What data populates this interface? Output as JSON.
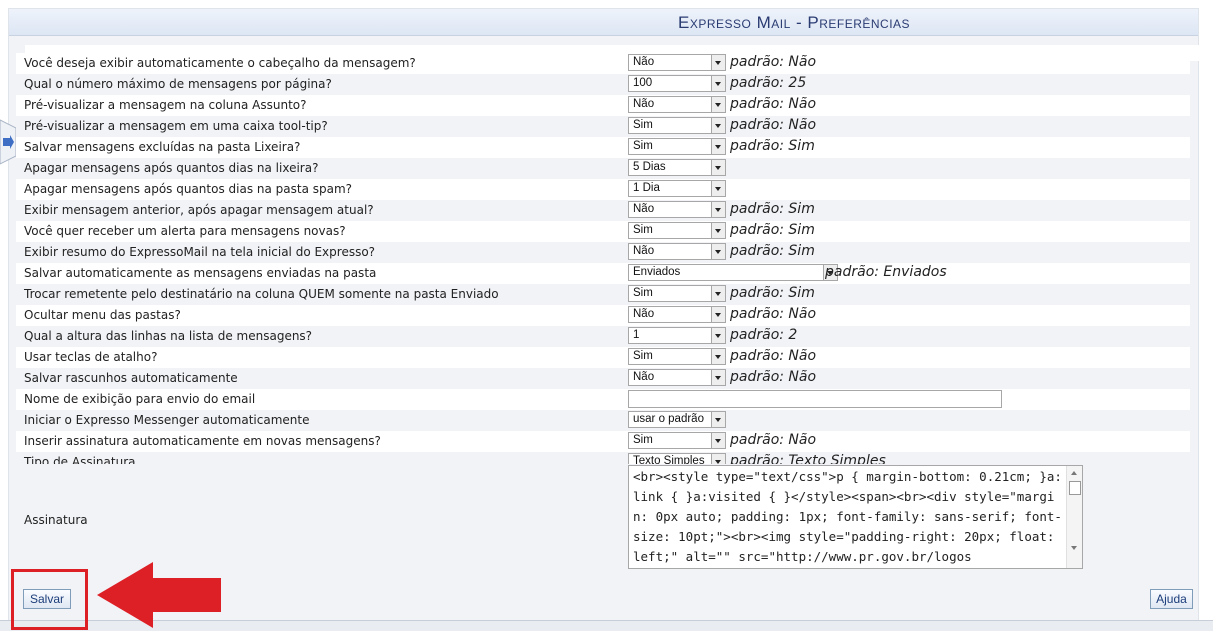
{
  "header": {
    "title": "Expresso Mail - Preferências"
  },
  "preferences": [
    {
      "question": "Você deseja exibir automaticamente o cabeçalho da mensagem?",
      "value": "Não",
      "default": "padrão: Não"
    },
    {
      "question": "Qual o número máximo de mensagens por página?",
      "value": "100",
      "default": "padrão: 25"
    },
    {
      "question": "Pré-visualizar a mensagem na coluna Assunto?",
      "value": "Não",
      "default": "padrão: Não"
    },
    {
      "question": "Pré-visualizar a mensagem em uma caixa tool-tip?",
      "value": "Sim",
      "default": "padrão: Não"
    },
    {
      "question": "Salvar mensagens excluídas na pasta Lixeira?",
      "value": "Sim",
      "default": "padrão: Sim"
    },
    {
      "question": "Apagar mensagens após quantos dias na lixeira?",
      "value": "5 Dias",
      "default": ""
    },
    {
      "question": "Apagar mensagens após quantos dias na pasta spam?",
      "value": "1 Dia",
      "default": ""
    },
    {
      "question": "Exibir mensagem anterior, após apagar mensagem atual?",
      "value": "Não",
      "default": "padrão: Sim"
    },
    {
      "question": "Você quer receber um alerta para mensagens novas?",
      "value": "Sim",
      "default": "padrão: Sim"
    },
    {
      "question": "Exibir resumo do ExpressoMail na tela inicial do Expresso?",
      "value": "Não",
      "default": "padrão: Sim"
    },
    {
      "question": "Salvar automaticamente as mensagens enviadas na pasta",
      "value": "Enviados",
      "default": "padrão: Enviados"
    },
    {
      "question": "Trocar remetente pelo destinatário na coluna QUEM somente na pasta Enviado",
      "value": "Sim",
      "default": "padrão: Sim"
    },
    {
      "question": "Ocultar menu das pastas?",
      "value": "Não",
      "default": "padrão: Não"
    },
    {
      "question": "Qual a altura das linhas na lista de mensagens?",
      "value": "1",
      "default": "padrão: 2"
    },
    {
      "question": "Usar teclas de atalho?",
      "value": "Sim",
      "default": "padrão: Não"
    },
    {
      "question": "Salvar rascunhos automaticamente",
      "value": "Não",
      "default": "padrão: Não"
    },
    {
      "question": "Nome de exibição para envio do email",
      "value": "",
      "default": ""
    },
    {
      "question": "Iniciar o Expresso Messenger automaticamente",
      "value": "usar o padrão",
      "default": ""
    },
    {
      "question": "Inserir assinatura automaticamente em novas mensagens?",
      "value": "Sim",
      "default": "padrão: Não"
    },
    {
      "question": "Tipo de Assinatura",
      "value": "Texto Simples",
      "default": "padrão: Texto Simples"
    }
  ],
  "signature": {
    "label": "Assinatura",
    "content": "<br><style type=\"text/css\">p { margin-bottom: 0.21cm; }a:link { }a:visited { }</style><span><br><div style=\"margin: 0px auto; padding: 1px; font-family: sans-serif; font-size: 10pt;\"><br><img style=\"padding-right: 20px; float: left;\" alt=\"\" src=\"http://www.pr.gov.br/logos"
  },
  "buttons": {
    "save": "Salvar",
    "help": "Ajuda"
  },
  "colors": {
    "highlight": "#dd1f26",
    "title": "#2a3b72"
  },
  "icons": {
    "sidetab": "arrow-right-icon",
    "annotation": "red-arrow-left"
  }
}
